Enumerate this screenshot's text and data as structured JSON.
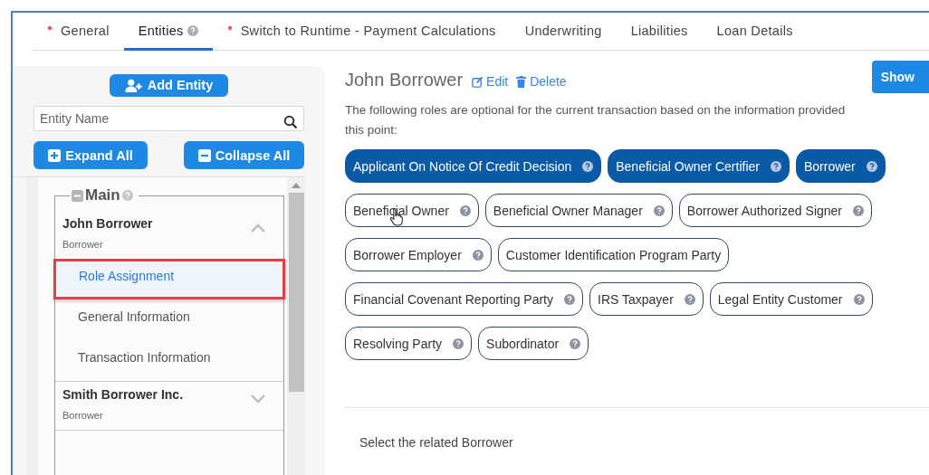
{
  "tabs": [
    {
      "label": "General",
      "required": true,
      "help": false,
      "selected": false
    },
    {
      "label": "Entities",
      "required": false,
      "help": true,
      "selected": true
    },
    {
      "label": "Switch to Runtime - Payment Calculations",
      "required": true,
      "help": false,
      "selected": false
    },
    {
      "label": "Underwriting",
      "required": false,
      "help": false,
      "selected": false
    },
    {
      "label": "Liabilities",
      "required": false,
      "help": false,
      "selected": false
    },
    {
      "label": "Loan Details",
      "required": false,
      "help": false,
      "selected": false
    }
  ],
  "sidebar": {
    "add_button": "Add Entity",
    "search": {
      "placeholder": "Entity Name"
    },
    "expand_button": "Expand All",
    "collapse_button": "Collapse All",
    "group": {
      "label": "Main",
      "entities": [
        {
          "name": "John Borrower",
          "type": "Borrower",
          "expanded": true,
          "children": [
            {
              "label": "Role Assignment",
              "selected": true
            },
            {
              "label": "General Information",
              "selected": false
            },
            {
              "label": "Transaction Information",
              "selected": false
            }
          ]
        },
        {
          "name": "Smith Borrower Inc.",
          "type": "Borrower",
          "expanded": false
        }
      ]
    }
  },
  "content": {
    "title": "John Borrower",
    "edit_link": "Edit",
    "delete_link": "Delete",
    "show_button": "Show",
    "description_lines": [
      "The following roles are optional for the current transaction based on the information provided",
      "this point:"
    ],
    "roles": [
      {
        "label": "Applicant On Notice Of Credit Decision",
        "selected": true,
        "help": true
      },
      {
        "label": "Beneficial Owner Certifier",
        "selected": true,
        "help": true
      },
      {
        "label": "Borrower",
        "selected": true,
        "help": true
      },
      {
        "label": "Beneficial Owner",
        "selected": false,
        "help": true
      },
      {
        "label": "Beneficial Owner Manager",
        "selected": false,
        "help": true
      },
      {
        "label": "Borrower Authorized Signer",
        "selected": false,
        "help": true
      },
      {
        "label": "Borrower Employer",
        "selected": false,
        "help": true
      },
      {
        "label": "Customer Identification Program Party",
        "selected": false,
        "help": false
      },
      {
        "label": "Financial Covenant Reporting Party",
        "selected": false,
        "help": true
      },
      {
        "label": "IRS Taxpayer",
        "selected": false,
        "help": true
      },
      {
        "label": "Legal Entity Customer",
        "selected": false,
        "help": true
      },
      {
        "label": "Resolving Party",
        "selected": false,
        "help": true
      },
      {
        "label": "Subordinator",
        "selected": false,
        "help": true
      }
    ],
    "related_label": "Select the related Borrower"
  }
}
